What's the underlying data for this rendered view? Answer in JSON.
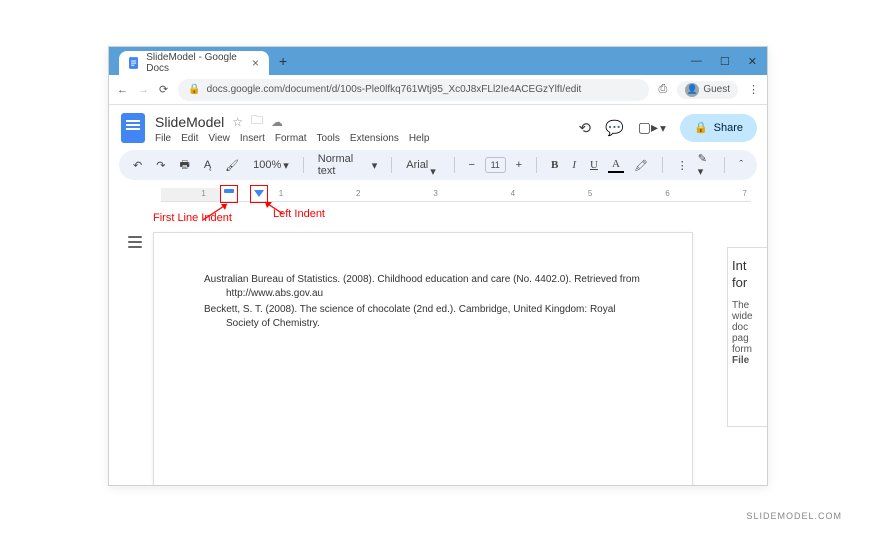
{
  "window": {
    "tab_title": "SlideModel - Google Docs",
    "guest_label": "Guest",
    "url": "docs.google.com/document/d/100s-Ple0lfkq761Wtj95_Xc0J8xFLl2Ie4ACEGzYlfI/edit"
  },
  "docs": {
    "title": "SlideModel",
    "menus": [
      "File",
      "Edit",
      "View",
      "Insert",
      "Format",
      "Tools",
      "Extensions",
      "Help"
    ],
    "share_label": "Share"
  },
  "toolbar": {
    "zoom": "100%",
    "style": "Normal text",
    "font": "Arial",
    "font_size": "11"
  },
  "ruler": {
    "numbers": [
      "",
      "1",
      "",
      "1",
      "",
      "2",
      "",
      "3",
      "",
      "4",
      "",
      "5",
      "",
      "6",
      "",
      "7"
    ]
  },
  "annotations": {
    "first_line_indent": "First Line Indent",
    "left_indent": "Left Indent"
  },
  "document": {
    "references": [
      "Australian Bureau of Statistics. (2008). Childhood education and care (No. 4402.0). Retrieved from http://www.abs.gov.au",
      "Beckett, S. T. (2008). The science of chocolate (2nd ed.). Cambridge, United Kingdom: Royal Society of Chemistry."
    ]
  },
  "sidepanel": {
    "heading1": "Int",
    "heading2": "for",
    "lines": [
      "The",
      "wide",
      "doc",
      "pag",
      "form"
    ],
    "bold_line": "File"
  },
  "watermark": "SLIDEMODEL.COM"
}
